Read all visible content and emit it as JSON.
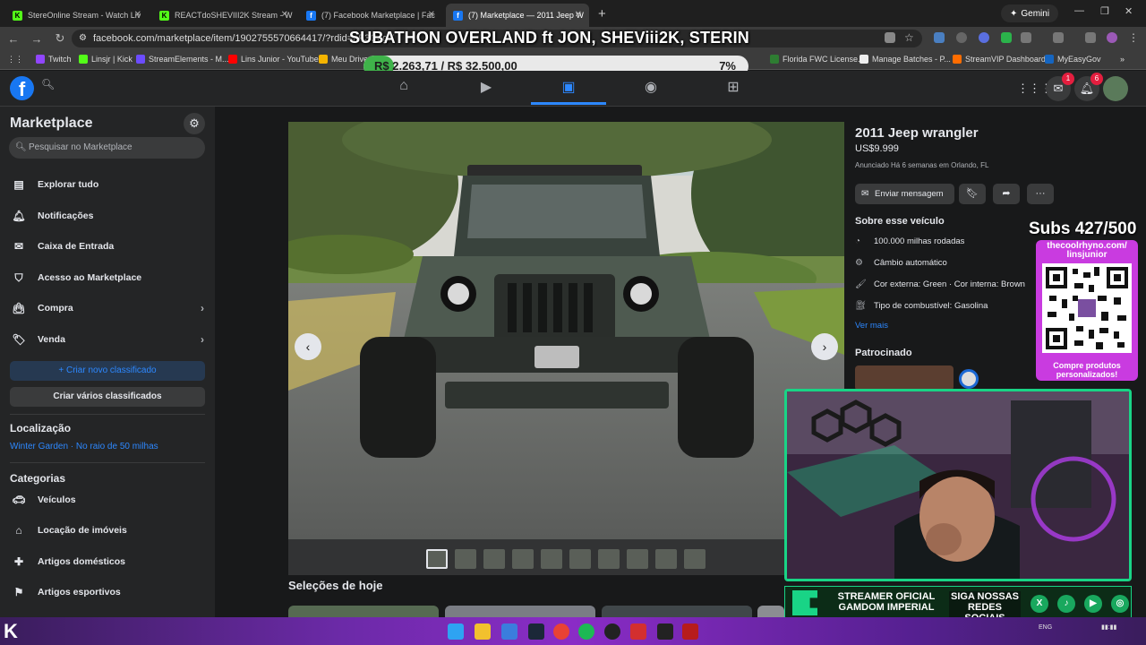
{
  "browser": {
    "tabs": [
      {
        "title": "StereOnline Stream - Watch Liv",
        "color": "#53fc18",
        "glyph": "K"
      },
      {
        "title": "REACTdoSHEVIII2K Stream - W",
        "color": "#53fc18",
        "glyph": "K"
      },
      {
        "title": "(7) Facebook Marketplace | Fac",
        "color": "#1877f2",
        "glyph": "f"
      },
      {
        "title": "(7) Marketplace — 2011 Jeep W",
        "color": "#1877f2",
        "glyph": "f"
      }
    ],
    "gemini_label": "Gemini",
    "url": "facebook.com/marketplace/item/1902755570664417/?rdid=nF3CegX",
    "bookmarks": [
      {
        "label": "Twitch",
        "color": "#9146ff"
      },
      {
        "label": "Linsjr | Kick",
        "color": "#53fc18"
      },
      {
        "label": "StreamElements - M...",
        "color": "#6c4cff"
      },
      {
        "label": "Lins Junior - YouTube",
        "color": "#ff0000"
      },
      {
        "label": "Meu Drive",
        "color": "#f4b400"
      },
      {
        "label": "Florida FWC License...",
        "color": "#2e7d32"
      },
      {
        "label": "Manage Batches - P...",
        "color": "#eeeeee"
      },
      {
        "label": "StreamVIP Dashboard",
        "color": "#ff6d00"
      },
      {
        "label": "MyEasyGov",
        "color": "#1565c0"
      }
    ]
  },
  "stream_overlay": {
    "title": "SUBATHON OVERLAND ft JON, SHEViii2K, STERIN",
    "goal_text": "R$ 2.263,71 / R$ 32.500,00",
    "goal_percent_label": "7%",
    "goal_fraction": 0.07,
    "subs_text": "Subs 427/500",
    "qr_top": "thecoolrhyno.com/ linsjunior",
    "qr_bottom": "Compre produtos personalizados!",
    "banner_left": "STREAMER OFICIAL GAMDOM IMPERIAL",
    "banner_right": "SIGA NOSSAS REDES SOCIAIS",
    "social_icons": [
      "x-icon",
      "tiktok-icon",
      "youtube-icon",
      "instagram-icon"
    ],
    "accent": "#19d486"
  },
  "fb": {
    "notif_count": "6",
    "messenger_count": "1"
  },
  "sidebar": {
    "title": "Marketplace",
    "search_placeholder": "Pesquisar no Marketplace",
    "items": [
      {
        "label": "Explorar tudo",
        "icon": "store-icon"
      },
      {
        "label": "Notificações",
        "icon": "bell-icon"
      },
      {
        "label": "Caixa de Entrada",
        "icon": "inbox-icon"
      },
      {
        "label": "Acesso ao Marketplace",
        "icon": "shield-icon"
      },
      {
        "label": "Compra",
        "icon": "bag-icon"
      },
      {
        "label": "Venda",
        "icon": "tag-icon"
      }
    ],
    "create_listing": "Criar novo classificado",
    "create_multiple": "Criar vários classificados",
    "location_heading": "Localização",
    "location_value": "Winter Garden · No raio de 50 milhas",
    "categories_heading": "Categorias",
    "categories": [
      {
        "label": "Veículos",
        "icon": "car-icon"
      },
      {
        "label": "Locação de imóveis",
        "icon": "house-icon"
      },
      {
        "label": "Artigos domésticos",
        "icon": "home-goods-icon"
      },
      {
        "label": "Artigos esportivos",
        "icon": "sports-icon"
      }
    ]
  },
  "listing": {
    "title": "2011 Jeep wrangler",
    "price": "US$9.999",
    "meta": "Anunciado Há 6 semanas em Orlando, FL",
    "message_button": "Enviar mensagem",
    "about_heading": "Sobre esse veículo",
    "specs": [
      {
        "text": "100.000 milhas rodadas",
        "icon": "odometer-icon"
      },
      {
        "text": "Câmbio automático",
        "icon": "gearbox-icon"
      },
      {
        "text": "Cor externa: Green · Cor interna: Brown",
        "icon": "paint-icon"
      },
      {
        "text": "Tipo de combustível: Gasolina",
        "icon": "fuel-icon"
      }
    ],
    "see_more": "Ver mais",
    "sponsored_heading": "Patrocinado",
    "thumbnail_count": 10
  },
  "todays_picks": "Seleções de hoje"
}
